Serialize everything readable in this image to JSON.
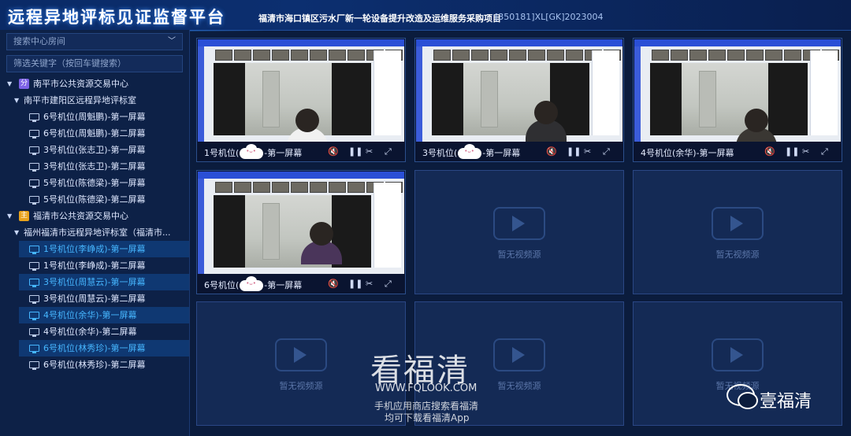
{
  "header": {
    "app_title": "远程异地评标见证监督平台",
    "project_name": "福清市海口镇区污水厂新一轮设备提升改造及运维服务采购项目",
    "project_code": "[350181]XL[GK]2023004"
  },
  "sidebar": {
    "room_search_placeholder": "搜索中心房间",
    "keyword_filter_placeholder": "筛选关键字（按回车键搜索）",
    "tree": [
      {
        "type": "center",
        "label": "南平市公共资源交易中心",
        "badge": "分",
        "badge_color": "#7d62e6"
      },
      {
        "type": "room",
        "label": "南平市建阳区远程异地评标室"
      },
      {
        "type": "seat",
        "label": "6号机位(周魁鹏)-第一屏幕",
        "active": false
      },
      {
        "type": "seat",
        "label": "6号机位(周魁鹏)-第二屏幕",
        "active": false
      },
      {
        "type": "seat",
        "label": "3号机位(张志卫)-第一屏幕",
        "active": false
      },
      {
        "type": "seat",
        "label": "3号机位(张志卫)-第二屏幕",
        "active": false
      },
      {
        "type": "seat",
        "label": "5号机位(陈德梁)-第一屏幕",
        "active": false
      },
      {
        "type": "seat",
        "label": "5号机位(陈德梁)-第二屏幕",
        "active": false
      },
      {
        "type": "center",
        "label": "福清市公共资源交易中心",
        "badge": "主",
        "badge_color": "#e8a31c"
      },
      {
        "type": "room",
        "label": "福州福清市远程异地评标室（福清市..."
      },
      {
        "type": "seat",
        "label": "1号机位(李峥成)-第一屏幕",
        "active": true
      },
      {
        "type": "seat",
        "label": "1号机位(李峥成)-第二屏幕",
        "active": false
      },
      {
        "type": "seat",
        "label": "3号机位(周慧云)-第一屏幕",
        "active": true
      },
      {
        "type": "seat",
        "label": "3号机位(周慧云)-第二屏幕",
        "active": false
      },
      {
        "type": "seat",
        "label": "4号机位(余华)-第一屏幕",
        "active": true
      },
      {
        "type": "seat",
        "label": "4号机位(余华)-第二屏幕",
        "active": false
      },
      {
        "type": "seat",
        "label": "6号机位(林秀珍)-第一屏幕",
        "active": true
      },
      {
        "type": "seat",
        "label": "6号机位(林秀珍)-第二屏幕",
        "active": false
      }
    ]
  },
  "grid": {
    "live_tiles": [
      {
        "label_prefix": "1号机位(",
        "label_suffix": "-第一屏幕",
        "masked": true
      },
      {
        "label_prefix": "3号机位(",
        "label_suffix": "-第一屏幕",
        "masked": true
      },
      {
        "label_prefix": "4号机位(余华)-第一屏幕",
        "label_suffix": "",
        "masked": false
      },
      {
        "label_prefix": "6号机位(",
        "label_suffix": "-第一屏幕",
        "masked": true
      }
    ],
    "empty_text": "暂无视频源",
    "control_icons": [
      "mute-icon",
      "pause-icon",
      "cut-icon",
      "fullscreen-icon"
    ]
  },
  "watermark": {
    "brand": "看福清",
    "url": "WWW.FQLOOK.COM",
    "line1": "手机应用商店搜索看福清",
    "line2": "均可下载看福清App",
    "wechat_name": "壹福清"
  }
}
